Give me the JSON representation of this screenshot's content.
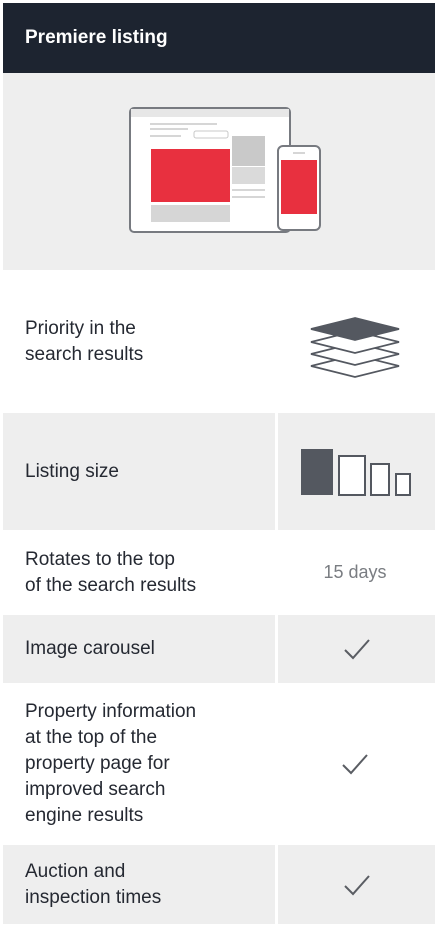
{
  "header": {
    "title": "Premiere listing"
  },
  "rows": [
    {
      "label": "Priority in the\nsearch results",
      "icon": "layers-icon"
    },
    {
      "label": "Listing size",
      "icon": "listing-size-icon"
    },
    {
      "label": "Rotates to the top\nof the search results",
      "value": "15 days"
    },
    {
      "label": "Image carousel",
      "icon": "check-icon"
    },
    {
      "label": "Property information\nat the top of the\nproperty page for\nimproved search\nengine results",
      "icon": "check-icon"
    },
    {
      "label": "Auction and\ninspection times",
      "icon": "check-icon"
    }
  ],
  "colors": {
    "header_bg": "#1d2430",
    "accent_red": "#e8303f",
    "row_gray": "#eeeeee",
    "icon_dark": "#545860"
  }
}
